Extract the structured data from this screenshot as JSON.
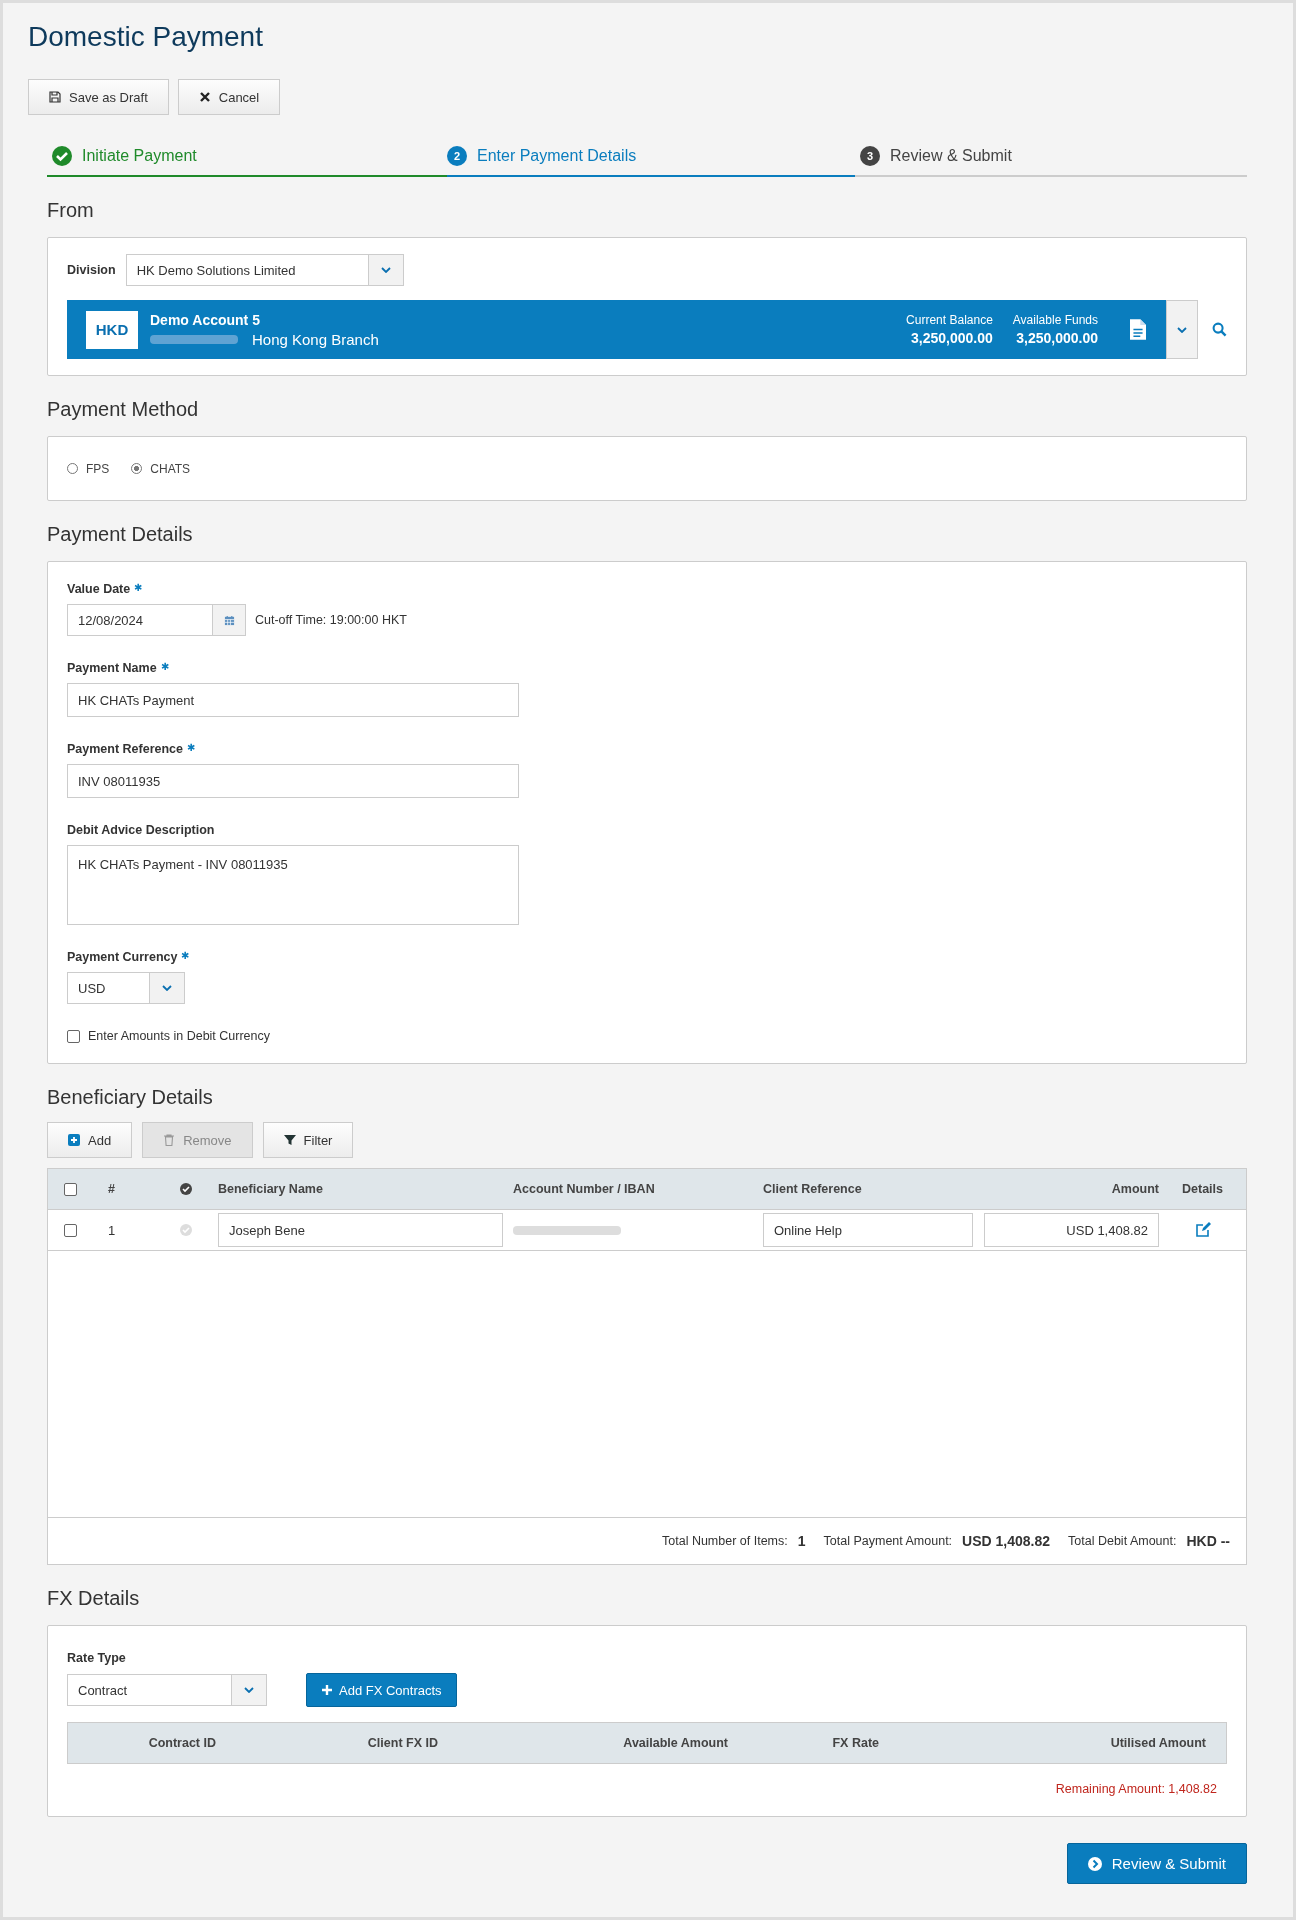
{
  "title": "Domestic Payment",
  "actions": [
    {
      "label": "Save as Draft",
      "kind": "save"
    },
    {
      "label": "Cancel",
      "kind": "cancel"
    }
  ],
  "steps": [
    {
      "label": "Initiate Payment",
      "completed": true,
      "selected": false
    },
    {
      "label": "Enter Payment Details",
      "number": "2",
      "completed": false,
      "selected": true
    },
    {
      "label": "Review & Submit",
      "number": "3",
      "completed": false,
      "selected": false
    }
  ],
  "from": {
    "heading": "From",
    "division_label": "Division",
    "division": "HK Demo Solutions Limited",
    "account": {
      "currency": "HKD",
      "name": "Demo Account 5",
      "branch": "Hong Kong Branch",
      "balances": [
        {
          "label": "Current Balance",
          "value": "3,250,000.00"
        },
        {
          "label": "Available Funds",
          "value": "3,250,000.00"
        }
      ]
    }
  },
  "payment_method": {
    "heading": "Payment Method",
    "options": [
      {
        "label": "FPS",
        "selected": false
      },
      {
        "label": "CHATS",
        "selected": true
      }
    ]
  },
  "payment_details": {
    "heading": "Payment Details",
    "fields": [
      {
        "kind": "date",
        "label": "Value Date",
        "required_mark": "✱",
        "value": "12/08/2024",
        "note": "Cut-off Time: 19:00:00 HKT"
      },
      {
        "kind": "text",
        "label": "Payment Name",
        "required_mark": "✱",
        "value": "HK CHATs Payment"
      },
      {
        "kind": "text",
        "label": "Payment Reference",
        "required_mark": "✱",
        "value": "INV 08011935"
      },
      {
        "kind": "textarea",
        "label": "Debit Advice Description",
        "value": "HK CHATs Payment - INV 08011935"
      },
      {
        "kind": "select",
        "label": "Payment Currency",
        "required_mark": "✱",
        "value": "USD"
      }
    ],
    "checkbox": {
      "label": "Enter Amounts in Debit Currency",
      "checked": false
    }
  },
  "beneficiary": {
    "heading": "Beneficiary Details",
    "buttons": [
      {
        "label": "Add",
        "kind": "add",
        "disabled": false
      },
      {
        "label": "Remove",
        "kind": "remove",
        "disabled": true
      },
      {
        "label": "Filter",
        "kind": "filter",
        "disabled": false
      }
    ],
    "select_all": {
      "checked": false
    },
    "columns": [
      "#",
      "Beneficiary Name",
      "Account Number / IBAN",
      "Client Reference",
      "Amount",
      "Details"
    ],
    "rows": [
      {
        "selected": false,
        "number": "1",
        "beneficiary_name": "Joseph Bene",
        "client_reference": "Online Help",
        "amount": "USD 1,408.82"
      }
    ],
    "totals": [
      {
        "label": "Total Number of Items:",
        "value": "1"
      },
      {
        "label": "Total Payment Amount:",
        "value": "USD 1,408.82"
      },
      {
        "label": "Total Debit Amount:",
        "value": "HKD --"
      }
    ]
  },
  "fx": {
    "heading": "FX Details",
    "rate_type_label": "Rate Type",
    "rate_type": "Contract",
    "add_button": "Add FX Contracts",
    "columns": [
      "Contract ID",
      "Client FX ID",
      "Available Amount",
      "FX Rate",
      "Utilised Amount"
    ],
    "remaining": "Remaining Amount: 1,408.82"
  },
  "submit": "Review & Submit"
}
